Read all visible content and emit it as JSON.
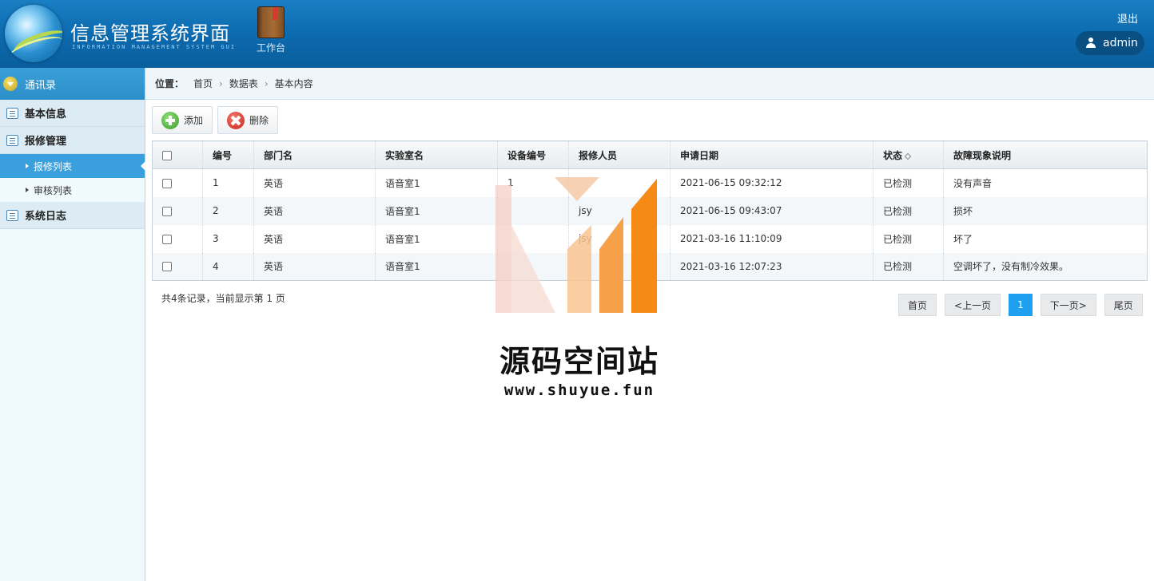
{
  "header": {
    "app_title": "信息管理系统界面",
    "app_subtitle": "INFORMATION MANAGEMENT SYSTEM GUI",
    "workbench_label": "工作台",
    "logout_label": "退出",
    "username": "admin"
  },
  "sidebar": {
    "title": "通讯录",
    "groups": [
      {
        "label": "基本信息"
      },
      {
        "label": "报修管理"
      }
    ],
    "subs": [
      {
        "label": "报修列表"
      },
      {
        "label": "审核列表"
      }
    ],
    "log_group": {
      "label": "系统日志"
    }
  },
  "breadcrumb": {
    "prefix": "位置：",
    "items": [
      "首页",
      "数据表",
      "基本内容"
    ]
  },
  "toolbar": {
    "add_label": "添加",
    "delete_label": "删除"
  },
  "table": {
    "columns": [
      "编号",
      "部门名",
      "实验室名",
      "设备编号",
      "报修人员",
      "申请日期",
      "状态",
      "故障现象说明"
    ],
    "rows": [
      [
        "1",
        "英语",
        "语音室1",
        "1",
        "",
        "2021-06-15 09:32:12",
        "已检测",
        "没有声音"
      ],
      [
        "2",
        "英语",
        "语音室1",
        "",
        "jsy",
        "2021-06-15 09:43:07",
        "已检测",
        "损坏"
      ],
      [
        "3",
        "英语",
        "语音室1",
        "",
        "jsy",
        "2021-03-16 11:10:09",
        "已检测",
        "坏了"
      ],
      [
        "4",
        "英语",
        "语音室1",
        "",
        "",
        "2021-03-16 12:07:23",
        "已检测",
        "空调坏了，没有制冷效果。"
      ]
    ]
  },
  "summary": "共4条记录，当前显示第 1 页",
  "pager": {
    "first": "首页",
    "prev": "<上一页",
    "current": "1",
    "next": "下一页>",
    "last": "尾页"
  },
  "watermark": {
    "text": "源码空间站",
    "url": "www.shuyue.fun"
  },
  "colors": {
    "header_blue": "#0c69ad",
    "sidebar_active": "#3aa0dd",
    "pager_current": "#1e9fef"
  }
}
